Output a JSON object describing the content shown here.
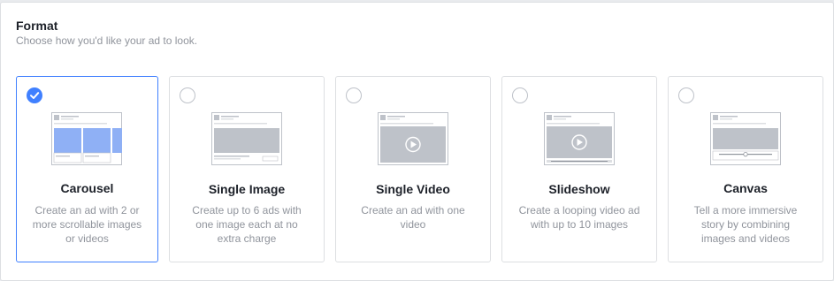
{
  "format": {
    "title": "Format",
    "subtitle": "Choose how you'd like your ad to look."
  },
  "cards": [
    {
      "id": "carousel",
      "title": "Carousel",
      "description": "Create an ad with 2 or more scrollable images or videos",
      "selected": true
    },
    {
      "id": "single-image",
      "title": "Single Image",
      "description": "Create up to 6 ads with one image each at no extra charge",
      "selected": false
    },
    {
      "id": "single-video",
      "title": "Single Video",
      "description": "Create an ad with one video",
      "selected": false
    },
    {
      "id": "slideshow",
      "title": "Slideshow",
      "description": "Create a looping video ad with up to 10 images",
      "selected": false
    },
    {
      "id": "canvas",
      "title": "Canvas",
      "description": "Tell a more immersive story by combining images and videos",
      "selected": false
    }
  ],
  "colors": {
    "accent": "#4080ff",
    "carousel_fill": "#8fb0f5",
    "placeholder_fill": "#bec2c9"
  },
  "icons": {
    "selected": "checkmark-icon",
    "video": "play-icon"
  }
}
